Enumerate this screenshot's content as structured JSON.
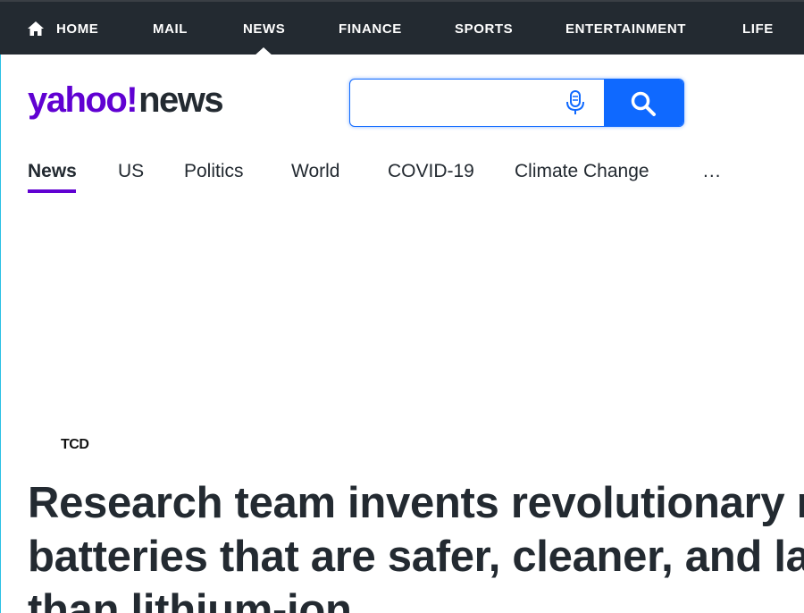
{
  "topnav": {
    "items": [
      {
        "label": "HOME"
      },
      {
        "label": "MAIL"
      },
      {
        "label": "NEWS"
      },
      {
        "label": "FINANCE"
      },
      {
        "label": "SPORTS"
      },
      {
        "label": "ENTERTAINMENT"
      },
      {
        "label": "LIFE"
      }
    ],
    "active": "NEWS"
  },
  "header": {
    "logo_brand": "yahoo!",
    "logo_product": "news",
    "search": {
      "value": "",
      "placeholder": ""
    }
  },
  "subnav": {
    "items": [
      {
        "label": "News"
      },
      {
        "label": "US"
      },
      {
        "label": "Politics"
      },
      {
        "label": "World"
      },
      {
        "label": "COVID-19"
      },
      {
        "label": "Climate Change"
      }
    ],
    "active": "News",
    "more_label": "..."
  },
  "article": {
    "source_logo_text": "TCD",
    "headline": "Research team invents revolutionary new batteries that are safer, cleaner, and last longer than lithium-ion"
  },
  "colors": {
    "topbar": "#232a31",
    "brand_purple": "#6001d2",
    "search_blue": "#0f69ff",
    "text": "#232a31"
  }
}
